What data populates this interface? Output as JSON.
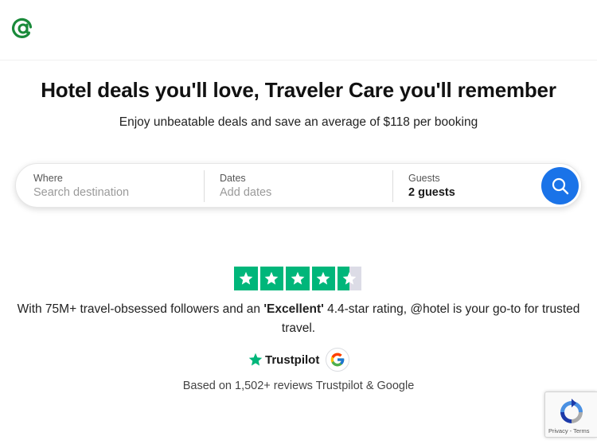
{
  "header": {
    "logo_icon": "at-sign-logo-icon",
    "brand_color": "#1a8a3a"
  },
  "hero": {
    "title": "Hotel deals you'll love, Traveler Care you'll remember",
    "subtitle": "Enjoy unbeatable deals and save an average of $118 per booking"
  },
  "search": {
    "where_label": "Where",
    "where_placeholder": "Search destination",
    "dates_label": "Dates",
    "dates_placeholder": "Add dates",
    "guests_label": "Guests",
    "guests_value": "2 guests",
    "button_icon": "search-icon",
    "button_color": "#1a73e8"
  },
  "reviews": {
    "star_rating": 4.4,
    "star_color": "#00b67a",
    "text_prefix": "With 75M+ travel-obsessed followers and an ",
    "text_bold": "'Excellent'",
    "text_suffix": " 4.4-star rating, @hotel is your go-to for trusted travel.",
    "trustpilot_label": "Trustpilot",
    "google_icon": "google-g-icon",
    "based_on": "Based on 1,502+ reviews Trustpilot & Google"
  },
  "recaptcha": {
    "privacy": "Privacy",
    "separator": " - ",
    "terms": "Terms"
  }
}
